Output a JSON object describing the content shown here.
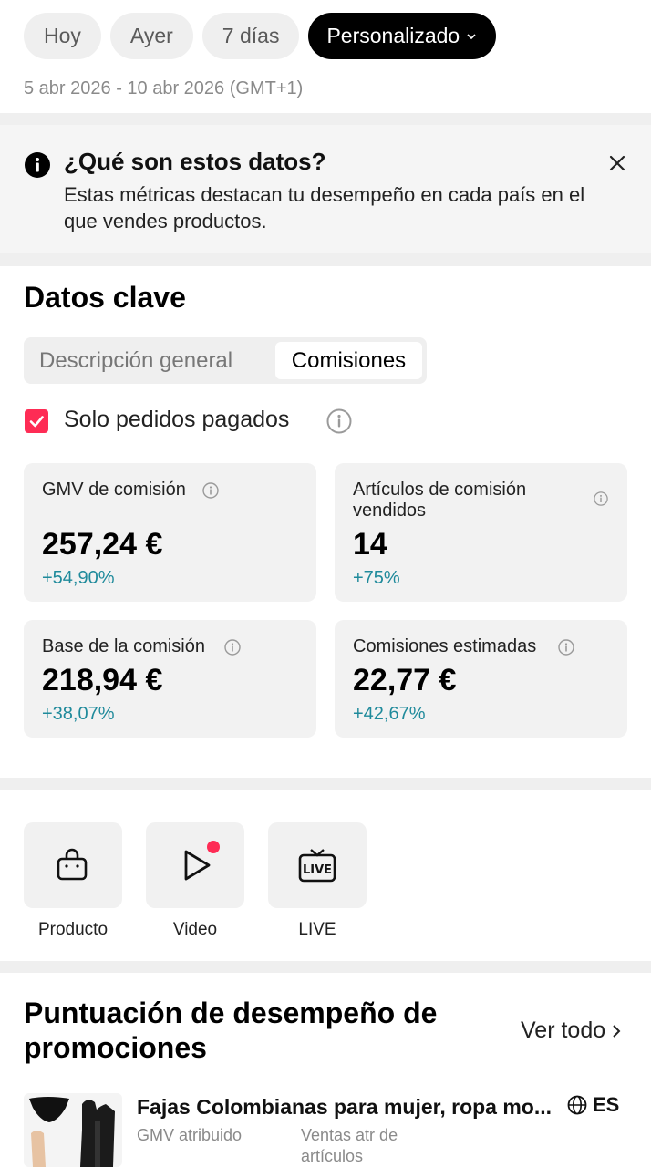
{
  "date_tabs": [
    {
      "label": "Hoy",
      "active": false
    },
    {
      "label": "Ayer",
      "active": false
    },
    {
      "label": "7 días",
      "active": false
    },
    {
      "label": "Personalizado",
      "active": true
    }
  ],
  "date_range": "5 abr 2026 - 10 abr 2026 (GMT+1)",
  "info_banner": {
    "title": "¿Qué son estos datos?",
    "text": "Estas métricas destacan tu desempeño en cada país en el que vendes productos.",
    "icon": "info-icon",
    "close_icon": "close-icon"
  },
  "key_data": {
    "title": "Datos clave",
    "tabs": [
      {
        "label": "Descripción general",
        "active": false
      },
      {
        "label": "Comisiones",
        "active": true
      }
    ],
    "filter": {
      "label": "Solo pedidos pagados",
      "checked": true
    },
    "cards": [
      {
        "label": "GMV de comisión",
        "value": "257,24 €",
        "delta": "+54,90%"
      },
      {
        "label": "Artículos de comisión vendidos",
        "value": "14",
        "delta": "+75%"
      },
      {
        "label": "Base de la comisión",
        "value": "218,94 €",
        "delta": "+38,07%"
      },
      {
        "label": "Comisiones estimadas",
        "value": "22,77 €",
        "delta": "+42,67%"
      }
    ]
  },
  "shortcuts": [
    {
      "label": "Producto",
      "icon": "shopping-bag-icon"
    },
    {
      "label": "Video",
      "icon": "play-icon",
      "has_badge": true
    },
    {
      "label": "LIVE",
      "icon": "live-tv-icon"
    }
  ],
  "promotions": {
    "title": "Puntuación de desempeño de promociones",
    "see_all": "Ver todo",
    "item": {
      "name": "Fajas Colombianas para mujer, ropa mo...",
      "region": "ES",
      "metric_1": "GMV atribuido",
      "metric_2": "Ventas atr de artículos"
    }
  },
  "colors": {
    "accent": "#fe2c55",
    "positive_delta": "#1f8a9b",
    "active_chip": "#000000",
    "chip_bg": "#efefef",
    "card_bg": "#f2f2f2"
  }
}
